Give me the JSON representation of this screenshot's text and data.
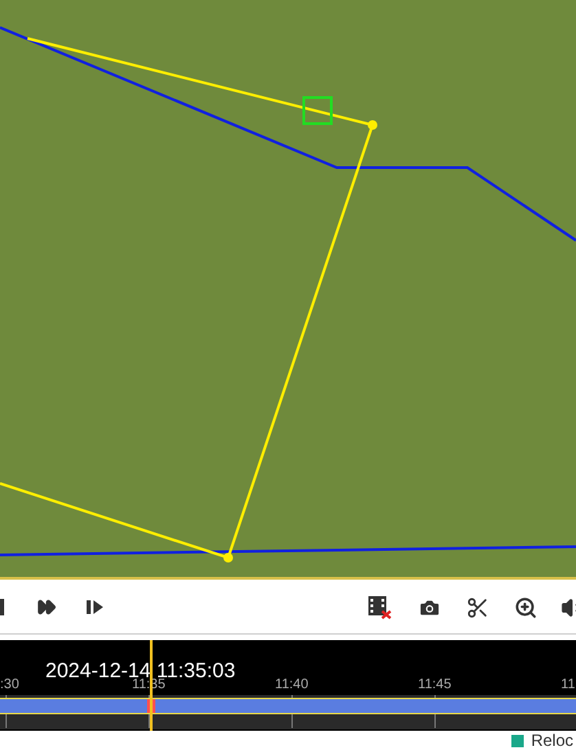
{
  "timeline": {
    "timestamp": "2024-12-14 11:35:03",
    "playhead": {
      "level": 0.262
    },
    "ticks": [
      {
        "label": ":30"
      },
      {
        "label": "11:35"
      },
      {
        "label": "11:40"
      },
      {
        "label": "11:45"
      },
      {
        "label": "11"
      }
    ]
  },
  "legend": [
    {
      "label": "Reloc",
      "color": "#1aa88a"
    }
  ]
}
